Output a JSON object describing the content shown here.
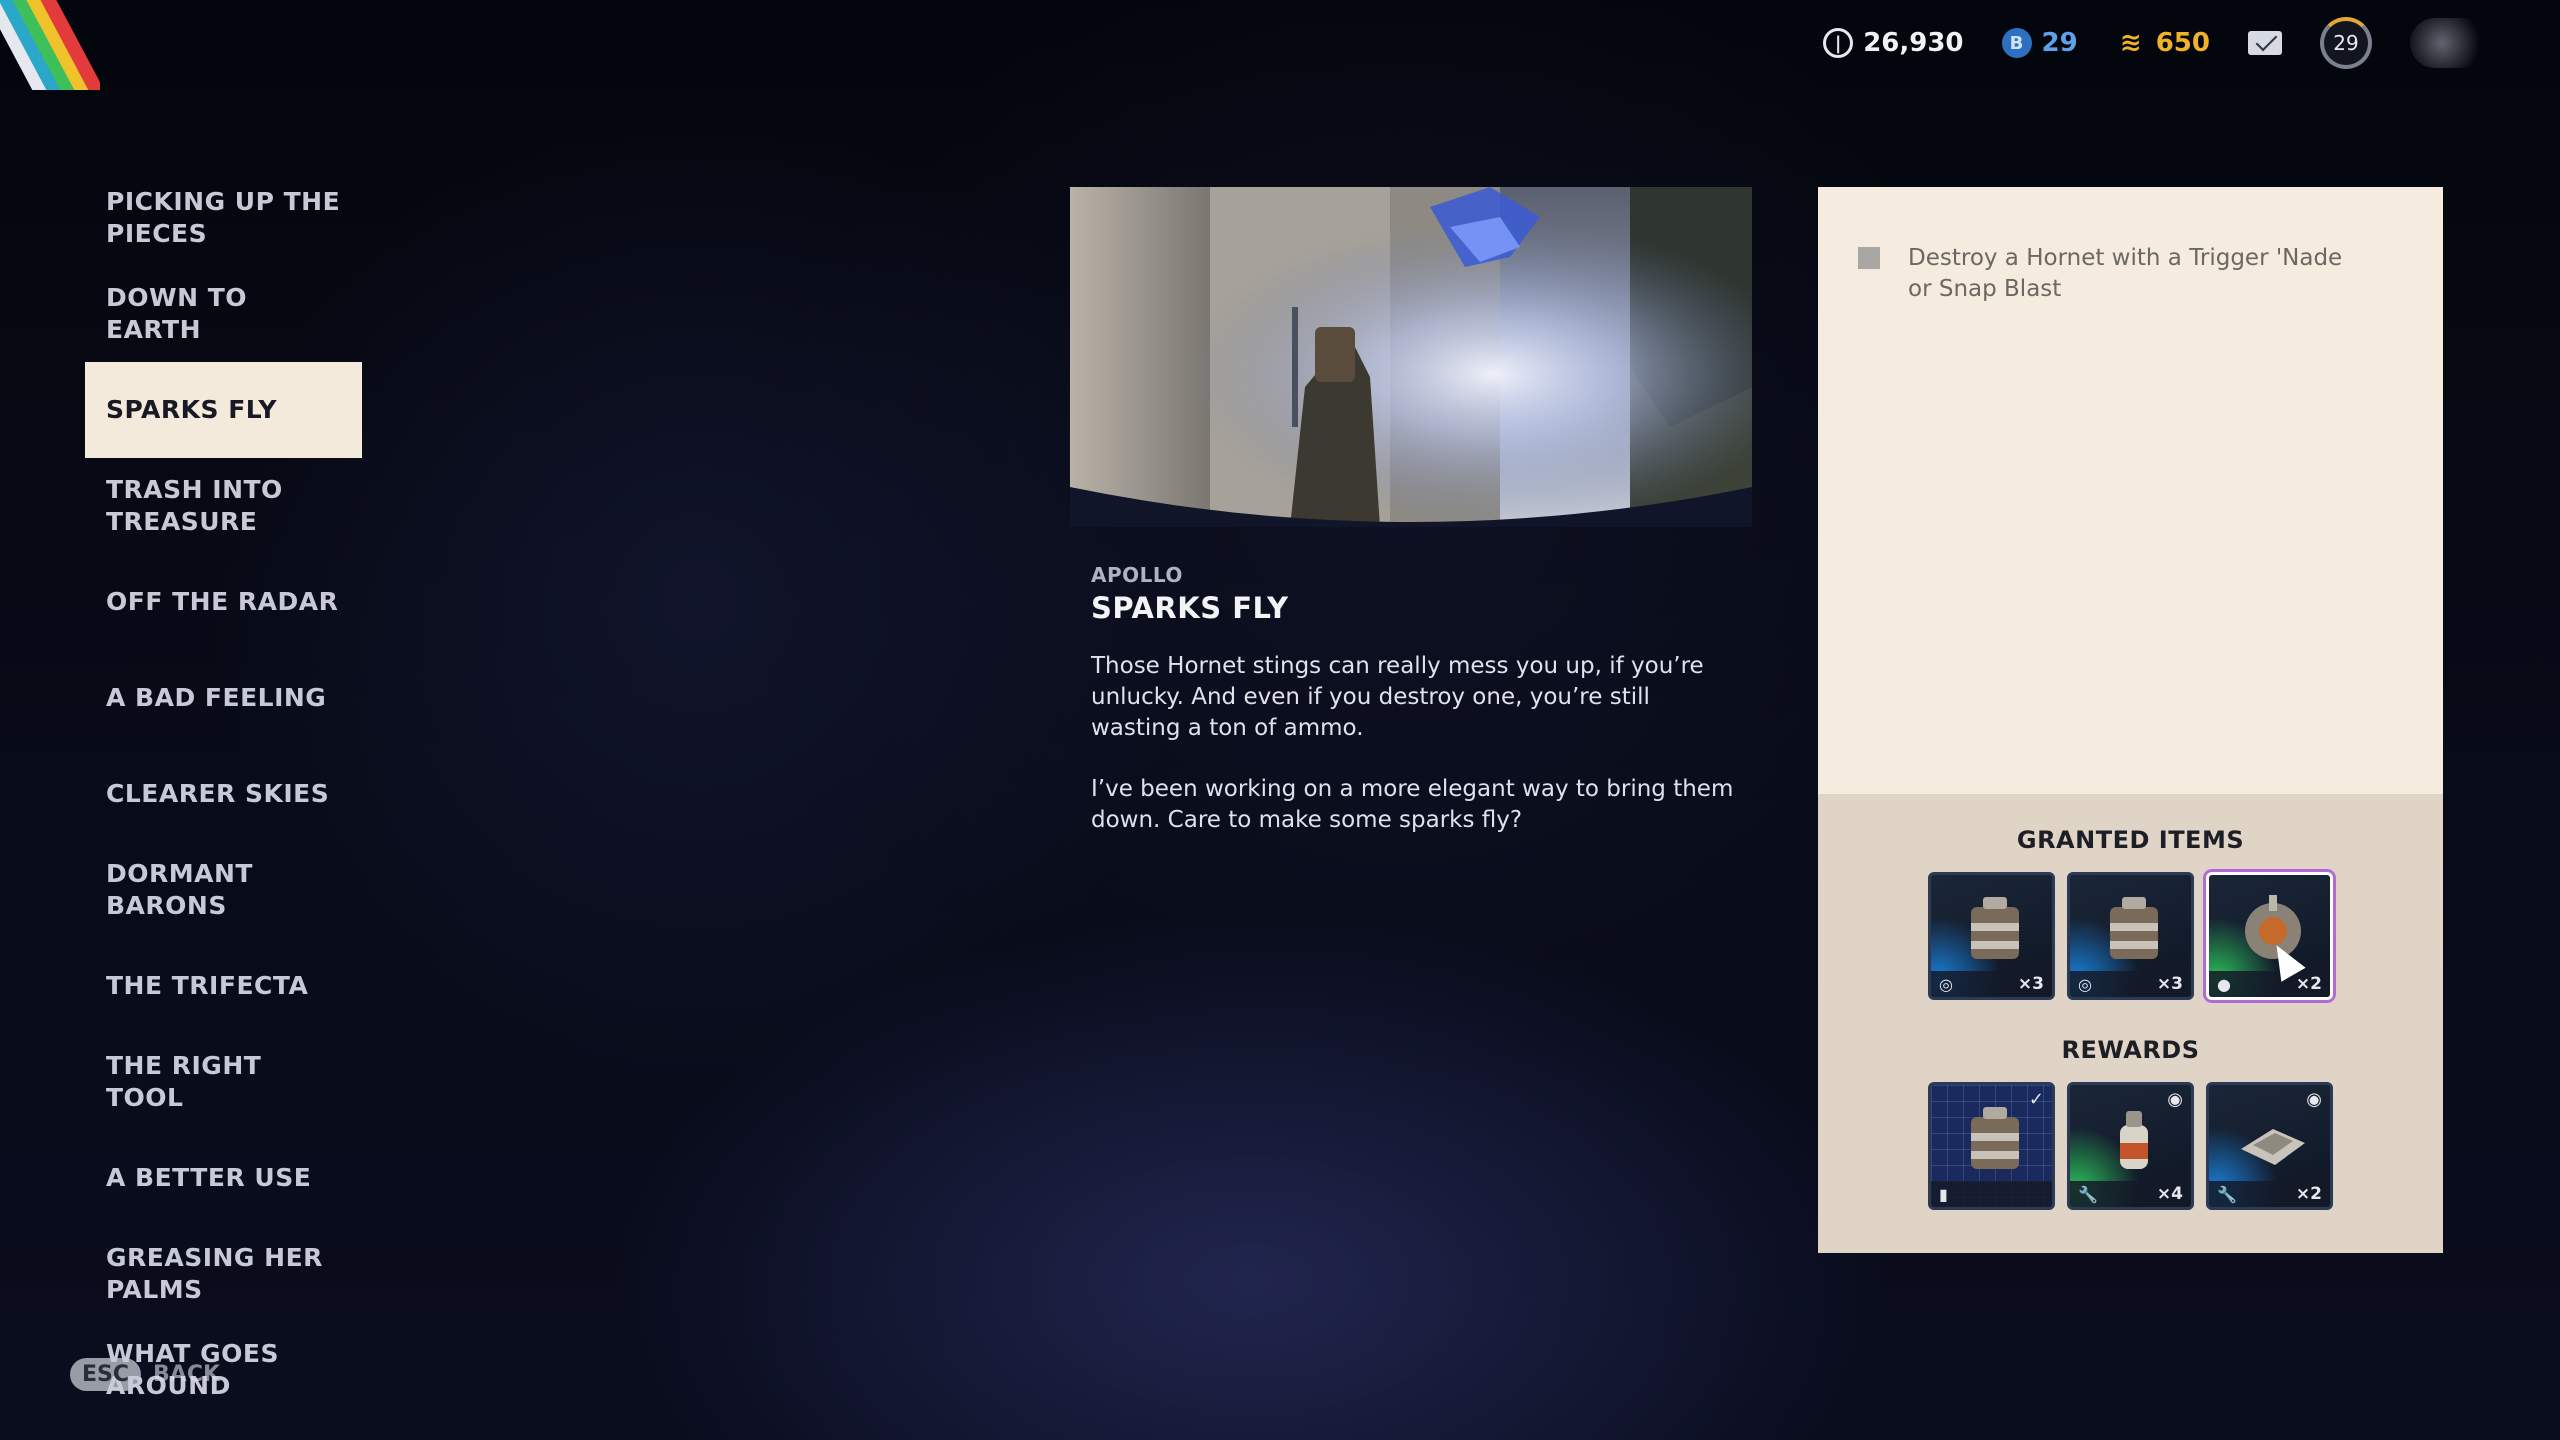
{
  "topbar": {
    "coins": {
      "icon": "coin-icon",
      "value": "26,930"
    },
    "tokens": {
      "icon": "token-icon",
      "value": "29"
    },
    "raider_points": {
      "icon": "raider-points-icon",
      "value": "650"
    },
    "mail": {
      "icon": "mail-icon"
    },
    "level": {
      "value": "29"
    }
  },
  "sidebar": {
    "items": [
      {
        "label": "PICKING UP THE PIECES",
        "active": false
      },
      {
        "label": "DOWN TO EARTH",
        "active": false
      },
      {
        "label": "SPARKS FLY",
        "active": true
      },
      {
        "label": "TRASH INTO TREASURE",
        "active": false
      },
      {
        "label": "OFF THE RADAR",
        "active": false
      },
      {
        "label": "A BAD FEELING",
        "active": false
      },
      {
        "label": "CLEARER SKIES",
        "active": false
      },
      {
        "label": "DORMANT BARONS",
        "active": false
      },
      {
        "label": "THE TRIFECTA",
        "active": false
      },
      {
        "label": "THE RIGHT TOOL",
        "active": false
      },
      {
        "label": "A BETTER USE",
        "active": false
      },
      {
        "label": "GREASING HER PALMS",
        "active": false
      },
      {
        "label": "WHAT GOES AROUND",
        "active": false
      }
    ]
  },
  "back_hint": {
    "key": "ESC",
    "label": "BACK"
  },
  "quest": {
    "giver": "APOLLO",
    "title": "SPARKS FLY",
    "description": [
      "Those Hornet stings can really mess you up, if you’re unlucky. And even if you destroy one, you’re still wasting a ton of ammo.",
      "I’ve been working on a more elegant way to bring them down. Care to make some sparks fly?"
    ]
  },
  "objectives": [
    {
      "text": "Destroy a Hornet with a Trigger 'Nade or Snap Blast",
      "completed": false
    }
  ],
  "granted_items": {
    "title": "GRANTED ITEMS",
    "items": [
      {
        "icon": "trigger-nade-icon",
        "qty": "×3",
        "rarity": "blue",
        "foot_icon": "target-icon"
      },
      {
        "icon": "trigger-nade-icon",
        "qty": "×3",
        "rarity": "blue",
        "foot_icon": "target-icon"
      },
      {
        "icon": "snap-blast-icon",
        "qty": "×2",
        "rarity": "green",
        "foot_icon": "grenade-icon",
        "selected": true
      }
    ]
  },
  "rewards": {
    "title": "REWARDS",
    "items": [
      {
        "icon": "blueprint-icon",
        "qty": "",
        "rarity": "grid",
        "foot_icon": "book-icon",
        "corner": "check-icon"
      },
      {
        "icon": "bottle-icon",
        "qty": "×4",
        "rarity": "green",
        "foot_icon": "wrench-icon",
        "corner": "eye-icon"
      },
      {
        "icon": "scrap-plate-icon",
        "qty": "×2",
        "rarity": "blue",
        "foot_icon": "wrench-icon",
        "corner": "eye-icon"
      }
    ]
  },
  "colors": {
    "accent_gold": "#f0b229",
    "token_blue": "#5fa0ea",
    "panel_cream": "#f5ebde",
    "panel_tan": "#dfd4c6",
    "active_item": "#f4eadb"
  }
}
